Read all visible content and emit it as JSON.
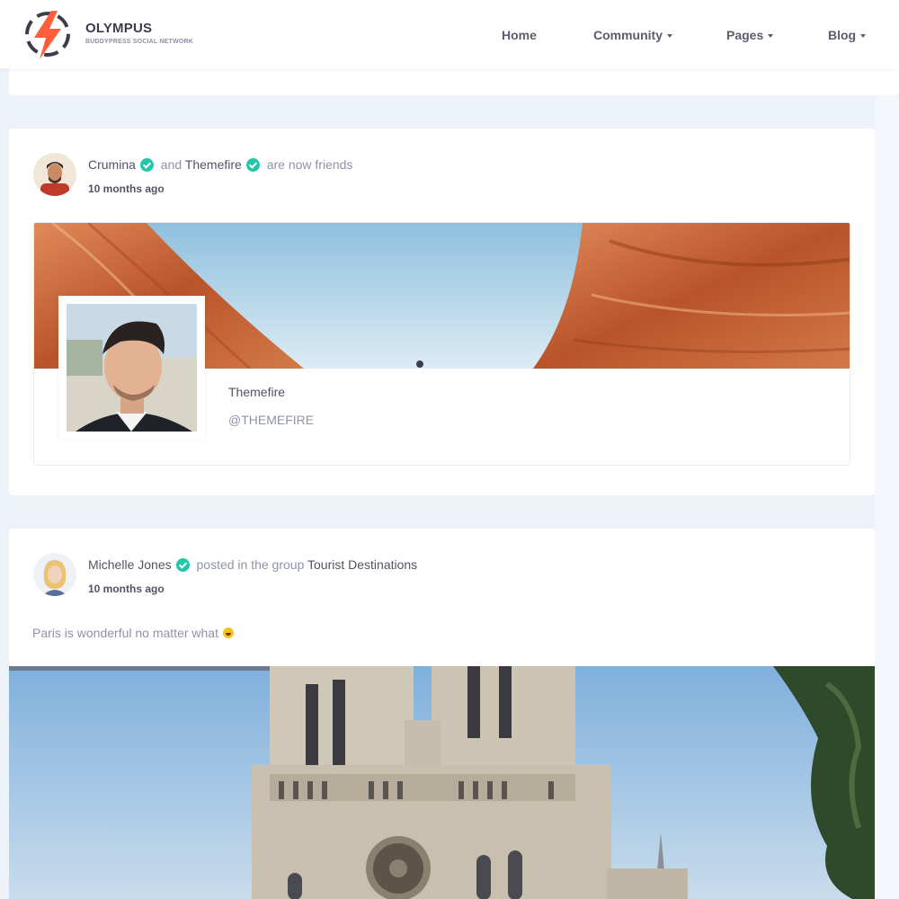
{
  "brand": {
    "name": "OLYMPUS",
    "tagline": "BUDDYPRESS SOCIAL NETWORK",
    "accent": "#ff5e3a"
  },
  "nav": {
    "home": "Home",
    "community": "Community",
    "pages": "Pages",
    "blog": "Blog"
  },
  "activity": [
    {
      "actor": "Crumina",
      "connector": "and",
      "target": "Themefire",
      "action": "are now friends",
      "time": "10 months ago",
      "friend_card": {
        "name": "Themefire",
        "handle": "@THEMEFIRE"
      }
    },
    {
      "actor": "Michelle Jones",
      "action": "posted in the group",
      "group": "Tourist Destinations",
      "time": "10 months ago",
      "text": "Paris is wonderful no matter what"
    }
  ],
  "colors": {
    "verified": "#21c7a8",
    "background": "#edf2f8",
    "muted_text": "#8f92a8",
    "primary_text": "#515365"
  }
}
